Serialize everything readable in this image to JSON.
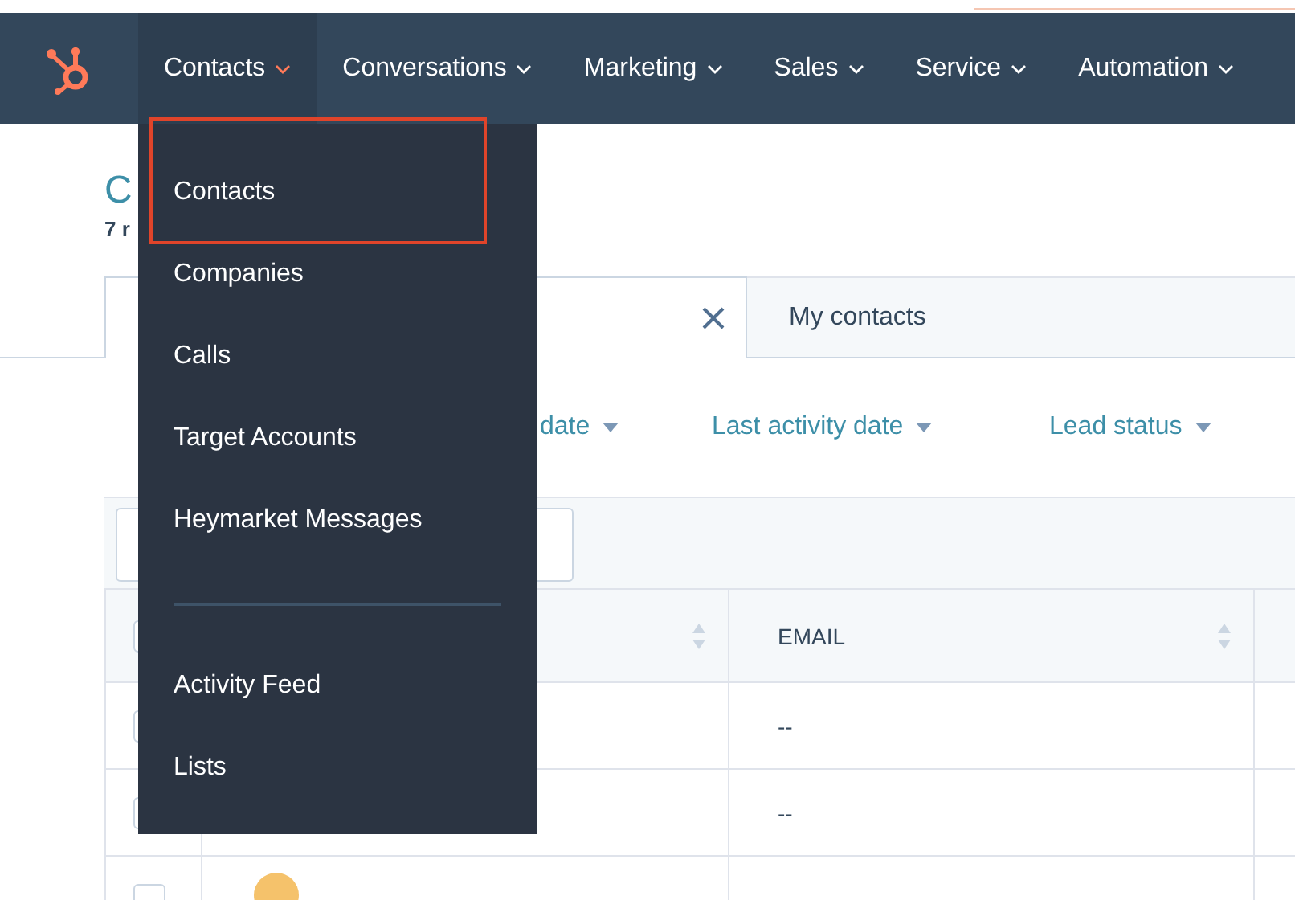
{
  "nav": {
    "items": [
      {
        "label": "Contacts",
        "selected": true
      },
      {
        "label": "Conversations",
        "selected": false
      },
      {
        "label": "Marketing",
        "selected": false
      },
      {
        "label": "Sales",
        "selected": false
      },
      {
        "label": "Service",
        "selected": false
      },
      {
        "label": "Automation",
        "selected": false
      }
    ]
  },
  "menu": {
    "sections": [
      {
        "items": [
          {
            "label": "Contacts",
            "highlighted": true
          },
          {
            "label": "Companies",
            "highlighted": false
          },
          {
            "label": "Calls",
            "highlighted": false
          },
          {
            "label": "Target Accounts",
            "highlighted": false
          },
          {
            "label": "Heymarket Messages",
            "highlighted": false
          }
        ]
      },
      {
        "items": [
          {
            "label": "Activity Feed",
            "highlighted": false
          },
          {
            "label": "Lists",
            "highlighted": false
          }
        ]
      }
    ]
  },
  "page": {
    "title": "C",
    "subtitle": "7 r",
    "tabs": [
      {
        "selected": true,
        "closable": true
      },
      {
        "label": "My contacts",
        "selected": false,
        "closable": false
      }
    ],
    "filters": [
      {
        "label": "date",
        "caret": true
      },
      {
        "label": "Last activity date",
        "caret": true
      },
      {
        "label": "Lead status",
        "caret": true
      }
    ],
    "table": {
      "columns": [
        {
          "kind": "checkbox",
          "checked": false
        },
        {
          "kind": "sortable"
        },
        {
          "kind": "sortable",
          "label": "EMAIL"
        },
        {
          "kind": "plain"
        }
      ],
      "rows": [
        {
          "kind": "email",
          "email": "--",
          "checked": false
        },
        {
          "kind": "email",
          "email": "--",
          "checked": false
        },
        {
          "kind": "avatar",
          "checked": false
        }
      ]
    }
  }
}
